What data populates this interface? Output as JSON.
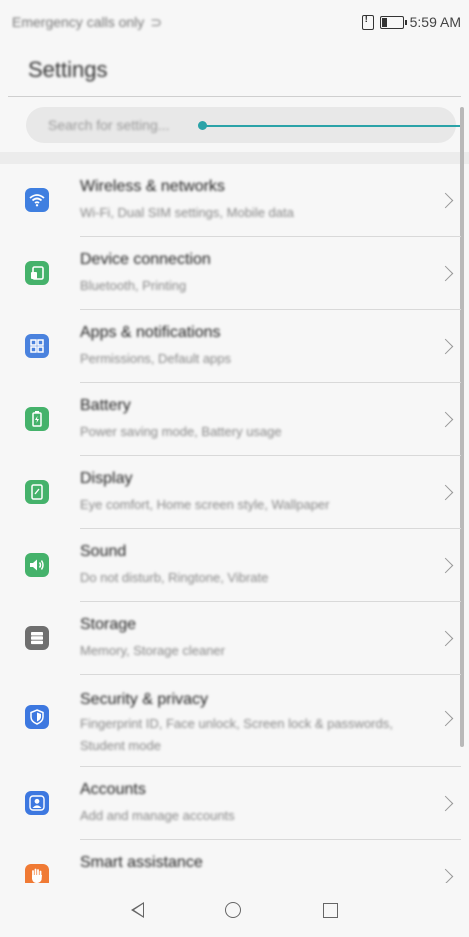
{
  "status_bar": {
    "left_text": "Emergency calls only",
    "time": "5:59 AM",
    "icons": [
      "wifi-calling-icon",
      "sim-alert-icon",
      "battery-icon"
    ]
  },
  "header": {
    "title": "Settings"
  },
  "search": {
    "placeholder": "Search for setting..."
  },
  "colors": {
    "accent_callout": "#2ba3a8",
    "wireless_icon": "#3f7fe0",
    "device_icon": "#45b26b",
    "apps_icon": "#4a82de",
    "battery_icon": "#45b26b",
    "display_icon": "#45b26b",
    "sound_icon": "#45b26b",
    "storage_icon": "#6f6f6f",
    "security_icon": "#3d78e0",
    "accounts_icon": "#3d78e0",
    "smart_icon": "#f07a34"
  },
  "items": [
    {
      "title": "Wireless & networks",
      "subtitle": "Wi-Fi, Dual SIM settings, Mobile data",
      "icon": "wifi-icon"
    },
    {
      "title": "Device connection",
      "subtitle": "Bluetooth, Printing",
      "icon": "device-connection-icon"
    },
    {
      "title": "Apps & notifications",
      "subtitle": "Permissions, Default apps",
      "icon": "apps-grid-icon"
    },
    {
      "title": "Battery",
      "subtitle": "Power saving mode, Battery usage",
      "icon": "battery-charge-icon"
    },
    {
      "title": "Display",
      "subtitle": "Eye comfort, Home screen style, Wallpaper",
      "icon": "display-icon"
    },
    {
      "title": "Sound",
      "subtitle": "Do not disturb, Ringtone, Vibrate",
      "icon": "speaker-icon"
    },
    {
      "title": "Storage",
      "subtitle": "Memory, Storage cleaner",
      "icon": "storage-icon"
    },
    {
      "title": "Security & privacy",
      "subtitle": "Fingerprint ID, Face unlock, Screen lock & passwords, Student mode",
      "icon": "shield-icon"
    },
    {
      "title": "Accounts",
      "subtitle": "Add and manage accounts",
      "icon": "account-icon"
    },
    {
      "title": "Smart assistance",
      "subtitle": "",
      "icon": "hand-icon"
    }
  ],
  "nav": {
    "back": "back-icon",
    "home": "home-icon",
    "recents": "recents-icon"
  }
}
